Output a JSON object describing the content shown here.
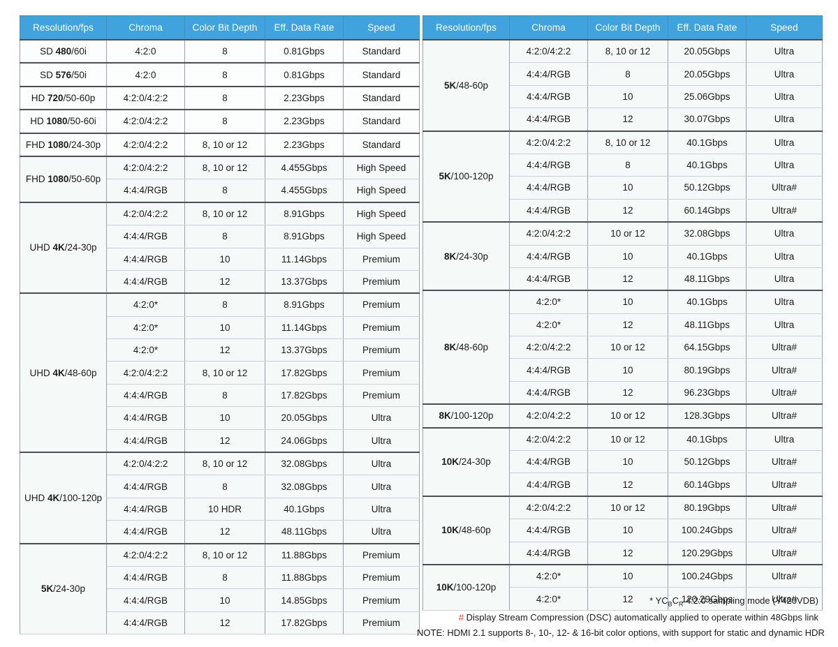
{
  "colors": {
    "header_bg": "#40a3de",
    "cell_bg": "#f5faf9",
    "standard": "#e8994a",
    "high_speed": "#7dc3e8",
    "premium": "#1a1a1a",
    "ultra": "#1a1a1a",
    "ultra_dsc": "#e03c31"
  },
  "columns": [
    "Resolution/fps",
    "Chroma",
    "Color Bit Depth",
    "Eff. Data Rate",
    "Speed"
  ],
  "left_table": {
    "headers": [
      "Resolution/fps",
      "Chroma",
      "Color Bit Depth",
      "Eff. Data Rate",
      "Speed"
    ],
    "groups": [
      {
        "res_prefix": "SD ",
        "res_bold": "480",
        "res_suffix": "/60i",
        "rows": [
          {
            "chroma": "4:2:0",
            "depth": "8",
            "rate": "0.81Gbps",
            "speed": "Standard",
            "speed_class": "sp-standard"
          }
        ]
      },
      {
        "res_prefix": "SD ",
        "res_bold": "576",
        "res_suffix": "/50i",
        "rows": [
          {
            "chroma": "4:2:0",
            "depth": "8",
            "rate": "0.81Gbps",
            "speed": "Standard",
            "speed_class": "sp-standard"
          }
        ]
      },
      {
        "res_prefix": "HD ",
        "res_bold": "720",
        "res_suffix": "/50-60p",
        "rows": [
          {
            "chroma": "4:2:0/4:2:2",
            "depth": "8",
            "rate": "2.23Gbps",
            "speed": "Standard",
            "speed_class": "sp-standard"
          }
        ]
      },
      {
        "res_prefix": "HD ",
        "res_bold": "1080",
        "res_suffix": "/50-60i",
        "rows": [
          {
            "chroma": "4:2:0/4:2:2",
            "depth": "8",
            "rate": "2.23Gbps",
            "speed": "Standard",
            "speed_class": "sp-standard"
          }
        ]
      },
      {
        "res_prefix": "FHD ",
        "res_bold": "1080",
        "res_suffix": "/24-30p",
        "rows": [
          {
            "chroma": "4:2:0/4:2:2",
            "depth": "8, 10 or 12",
            "rate": "2.23Gbps",
            "speed": "Standard",
            "speed_class": "sp-standard"
          }
        ]
      },
      {
        "res_prefix": "FHD ",
        "res_bold": "1080",
        "res_suffix": "/50-60p",
        "rows": [
          {
            "chroma": "4:2:0/4:2:2",
            "depth": "8, 10 or 12",
            "rate": "4.455Gbps",
            "speed": "High Speed",
            "speed_class": "sp-high"
          },
          {
            "chroma": "4:4:4/RGB",
            "depth": "8",
            "rate": "4.455Gbps",
            "speed": "High Speed",
            "speed_class": "sp-high"
          }
        ]
      },
      {
        "res_prefix": "UHD ",
        "res_bold": "4K",
        "res_suffix": "/24-30p",
        "rows": [
          {
            "chroma": "4:2:0/4:2:2",
            "depth": "8, 10 or 12",
            "rate": "8.91Gbps",
            "speed": "High Speed",
            "speed_class": "sp-high"
          },
          {
            "chroma": "4:4:4/RGB",
            "depth": "8",
            "rate": "8.91Gbps",
            "speed": "High Speed",
            "speed_class": "sp-high"
          },
          {
            "chroma": "4:4:4/RGB",
            "depth": "10",
            "rate": "11.14Gbps",
            "speed": "Premium",
            "speed_class": "sp-premium"
          },
          {
            "chroma": "4:4:4/RGB",
            "depth": "12",
            "rate": "13.37Gbps",
            "speed": "Premium",
            "speed_class": "sp-premium"
          }
        ]
      },
      {
        "res_prefix": "UHD ",
        "res_bold": "4K",
        "res_suffix": "/48-60p",
        "rows": [
          {
            "chroma": "4:2:0*",
            "depth": "8",
            "rate": "8.91Gbps",
            "speed": "Premium",
            "speed_class": "sp-premium"
          },
          {
            "chroma": "4:2:0*",
            "depth": "10",
            "rate": "11.14Gbps",
            "speed": "Premium",
            "speed_class": "sp-premium"
          },
          {
            "chroma": "4:2:0*",
            "depth": "12",
            "rate": "13.37Gbps",
            "speed": "Premium",
            "speed_class": "sp-premium"
          },
          {
            "chroma": "4:2:0/4:2:2",
            "depth": "8, 10 or 12",
            "rate": "17.82Gbps",
            "speed": "Premium",
            "speed_class": "sp-premium"
          },
          {
            "chroma": "4:4:4/RGB",
            "depth": "8",
            "rate": "17.82Gbps",
            "speed": "Premium",
            "speed_class": "sp-premium"
          },
          {
            "chroma": "4:4:4/RGB",
            "depth": "10",
            "rate": "20.05Gbps",
            "speed": "Ultra",
            "speed_class": "sp-ultra"
          },
          {
            "chroma": "4:4:4/RGB",
            "depth": "12",
            "rate": "24.06Gbps",
            "speed": "Ultra",
            "speed_class": "sp-ultra"
          }
        ]
      },
      {
        "res_prefix": "UHD ",
        "res_bold": "4K",
        "res_suffix": "/100-120p",
        "rows": [
          {
            "chroma": "4:2:0/4:2:2",
            "depth": "8, 10 or 12",
            "rate": "32.08Gbps",
            "speed": "Ultra",
            "speed_class": "sp-ultra"
          },
          {
            "chroma": "4:4:4/RGB",
            "depth": "8",
            "rate": "32.08Gbps",
            "speed": "Ultra",
            "speed_class": "sp-ultra"
          },
          {
            "chroma": "4:4:4/RGB",
            "depth": "10 HDR",
            "rate": "40.1Gbps",
            "speed": "Ultra",
            "speed_class": "sp-ultra"
          },
          {
            "chroma": "4:4:4/RGB",
            "depth": "12",
            "rate": "48.11Gbps",
            "speed": "Ultra",
            "speed_class": "sp-ultra"
          }
        ]
      },
      {
        "res_prefix": "",
        "res_bold": "5K",
        "res_suffix": "/24-30p",
        "rows": [
          {
            "chroma": "4:2:0/4:2:2",
            "depth": "8, 10 or 12",
            "rate": "11.88Gbps",
            "speed": "Premium",
            "speed_class": "sp-premium"
          },
          {
            "chroma": "4:4:4/RGB",
            "depth": "8",
            "rate": "11.88Gbps",
            "speed": "Premium",
            "speed_class": "sp-premium"
          },
          {
            "chroma": "4:4:4/RGB",
            "depth": "10",
            "rate": "14.85Gbps",
            "speed": "Premium",
            "speed_class": "sp-premium"
          },
          {
            "chroma": "4:4:4/RGB",
            "depth": "12",
            "rate": "17.82Gbps",
            "speed": "Premium",
            "speed_class": "sp-premium"
          }
        ]
      }
    ]
  },
  "right_table": {
    "headers": [
      "Resolution/fps",
      "Chroma",
      "Color Bit Depth",
      "Eff. Data Rate",
      "Speed"
    ],
    "groups": [
      {
        "res_prefix": "",
        "res_bold": "5K",
        "res_suffix": "/48-60p",
        "rows": [
          {
            "chroma": "4:2:0/4:2:2",
            "depth": "8, 10 or 12",
            "rate": "20.05Gbps",
            "speed": "Ultra",
            "speed_class": "sp-ultra"
          },
          {
            "chroma": "4:4:4/RGB",
            "depth": "8",
            "rate": "20.05Gbps",
            "speed": "Ultra",
            "speed_class": "sp-ultra"
          },
          {
            "chroma": "4:4:4/RGB",
            "depth": "10",
            "rate": "25.06Gbps",
            "speed": "Ultra",
            "speed_class": "sp-ultra"
          },
          {
            "chroma": "4:4:4/RGB",
            "depth": "12",
            "rate": "30.07Gbps",
            "speed": "Ultra",
            "speed_class": "sp-ultra"
          }
        ]
      },
      {
        "res_prefix": "",
        "res_bold": "5K",
        "res_suffix": "/100-120p",
        "rows": [
          {
            "chroma": "4:2:0/4:2:2",
            "depth": "8, 10 or 12",
            "rate": "40.1Gbps",
            "speed": "Ultra",
            "speed_class": "sp-ultra"
          },
          {
            "chroma": "4:4:4/RGB",
            "depth": "8",
            "rate": "40.1Gbps",
            "speed": "Ultra",
            "speed_class": "sp-ultra"
          },
          {
            "chroma": "4:4:4/RGB",
            "depth": "10",
            "rate": "50.12Gbps",
            "speed": "Ultra#",
            "speed_class": "sp-ultrah"
          },
          {
            "chroma": "4:4:4/RGB",
            "depth": "12",
            "rate": "60.14Gbps",
            "speed": "Ultra#",
            "speed_class": "sp-ultrah"
          }
        ]
      },
      {
        "res_prefix": "",
        "res_bold": "8K",
        "res_suffix": "/24-30p",
        "rows": [
          {
            "chroma": "4:2:0/4:2:2",
            "depth": "10 or 12",
            "rate": "32.08Gbps",
            "speed": "Ultra",
            "speed_class": "sp-ultra"
          },
          {
            "chroma": "4:4:4/RGB",
            "depth": "10",
            "rate": "40.1Gbps",
            "speed": "Ultra",
            "speed_class": "sp-ultra"
          },
          {
            "chroma": "4:4:4/RGB",
            "depth": "12",
            "rate": "48.11Gbps",
            "speed": "Ultra",
            "speed_class": "sp-ultra"
          }
        ]
      },
      {
        "res_prefix": "",
        "res_bold": "8K",
        "res_suffix": "/48-60p",
        "rows": [
          {
            "chroma": "4:2:0*",
            "depth": "10",
            "rate": "40.1Gbps",
            "speed": "Ultra",
            "speed_class": "sp-ultra"
          },
          {
            "chroma": "4:2:0*",
            "depth": "12",
            "rate": "48.11Gbps",
            "speed": "Ultra",
            "speed_class": "sp-ultra"
          },
          {
            "chroma": "4:2:0/4:2:2",
            "depth": "10 or 12",
            "rate": "64.15Gbps",
            "speed": "Ultra#",
            "speed_class": "sp-ultrah"
          },
          {
            "chroma": "4:4:4/RGB",
            "depth": "10",
            "rate": "80.19Gbps",
            "speed": "Ultra#",
            "speed_class": "sp-ultrah"
          },
          {
            "chroma": "4:4:4/RGB",
            "depth": "12",
            "rate": "96.23Gbps",
            "speed": "Ultra#",
            "speed_class": "sp-ultrah"
          }
        ]
      },
      {
        "res_prefix": "",
        "res_bold": "8K",
        "res_suffix": "/100-120p",
        "rows": [
          {
            "chroma": "4:2:0/4:2:2",
            "depth": "10 or 12",
            "rate": "128.3Gbps",
            "speed": "Ultra#",
            "speed_class": "sp-ultrah"
          }
        ]
      },
      {
        "res_prefix": "",
        "res_bold": "10K",
        "res_suffix": "/24-30p",
        "rows": [
          {
            "chroma": "4:2:0/4:2:2",
            "depth": "10 or 12",
            "rate": "40.1Gbps",
            "speed": "Ultra",
            "speed_class": "sp-ultra"
          },
          {
            "chroma": "4:4:4/RGB",
            "depth": "10",
            "rate": "50.12Gbps",
            "speed": "Ultra#",
            "speed_class": "sp-ultrah"
          },
          {
            "chroma": "4:4:4/RGB",
            "depth": "12",
            "rate": "60.14Gbps",
            "speed": "Ultra#",
            "speed_class": "sp-ultrah"
          }
        ]
      },
      {
        "res_prefix": "",
        "res_bold": "10K",
        "res_suffix": "/48-60p",
        "rows": [
          {
            "chroma": "4:2:0/4:2:2",
            "depth": "10 or 12",
            "rate": "80.19Gbps",
            "speed": "Ultra#",
            "speed_class": "sp-ultrah"
          },
          {
            "chroma": "4:4:4/RGB",
            "depth": "10",
            "rate": "100.24Gbps",
            "speed": "Ultra#",
            "speed_class": "sp-ultrah"
          },
          {
            "chroma": "4:4:4/RGB",
            "depth": "12",
            "rate": "120.29Gbps",
            "speed": "Ultra#",
            "speed_class": "sp-ultrah"
          }
        ]
      },
      {
        "res_prefix": "",
        "res_bold": "10K",
        "res_suffix": "/100-120p",
        "rows": [
          {
            "chroma": "4:2:0*",
            "depth": "10",
            "rate": "100.24Gbps",
            "speed": "Ultra#",
            "speed_class": "sp-ultrah"
          },
          {
            "chroma": "4:2:0*",
            "depth": "12",
            "rate": "120.29Gbps",
            "speed": "Ultra#",
            "speed_class": "sp-ultrah"
          }
        ]
      }
    ]
  },
  "footnotes": {
    "asterisk": {
      "mark": "*",
      "text_before_sub": " YC",
      "sub1": "B",
      "mid": "C",
      "sub2": "R",
      "text_after": " 4:2:0 sampling mode (Y420VDB)"
    },
    "hash": {
      "mark": "#",
      "text": " Display Stream Compression (DSC) automatically applied to operate within 48Gbps link"
    },
    "note": "NOTE: HDMI 2.1 supports 8-, 10-, 12- & 16-bit color options, with support for static and dynamic HDR"
  }
}
